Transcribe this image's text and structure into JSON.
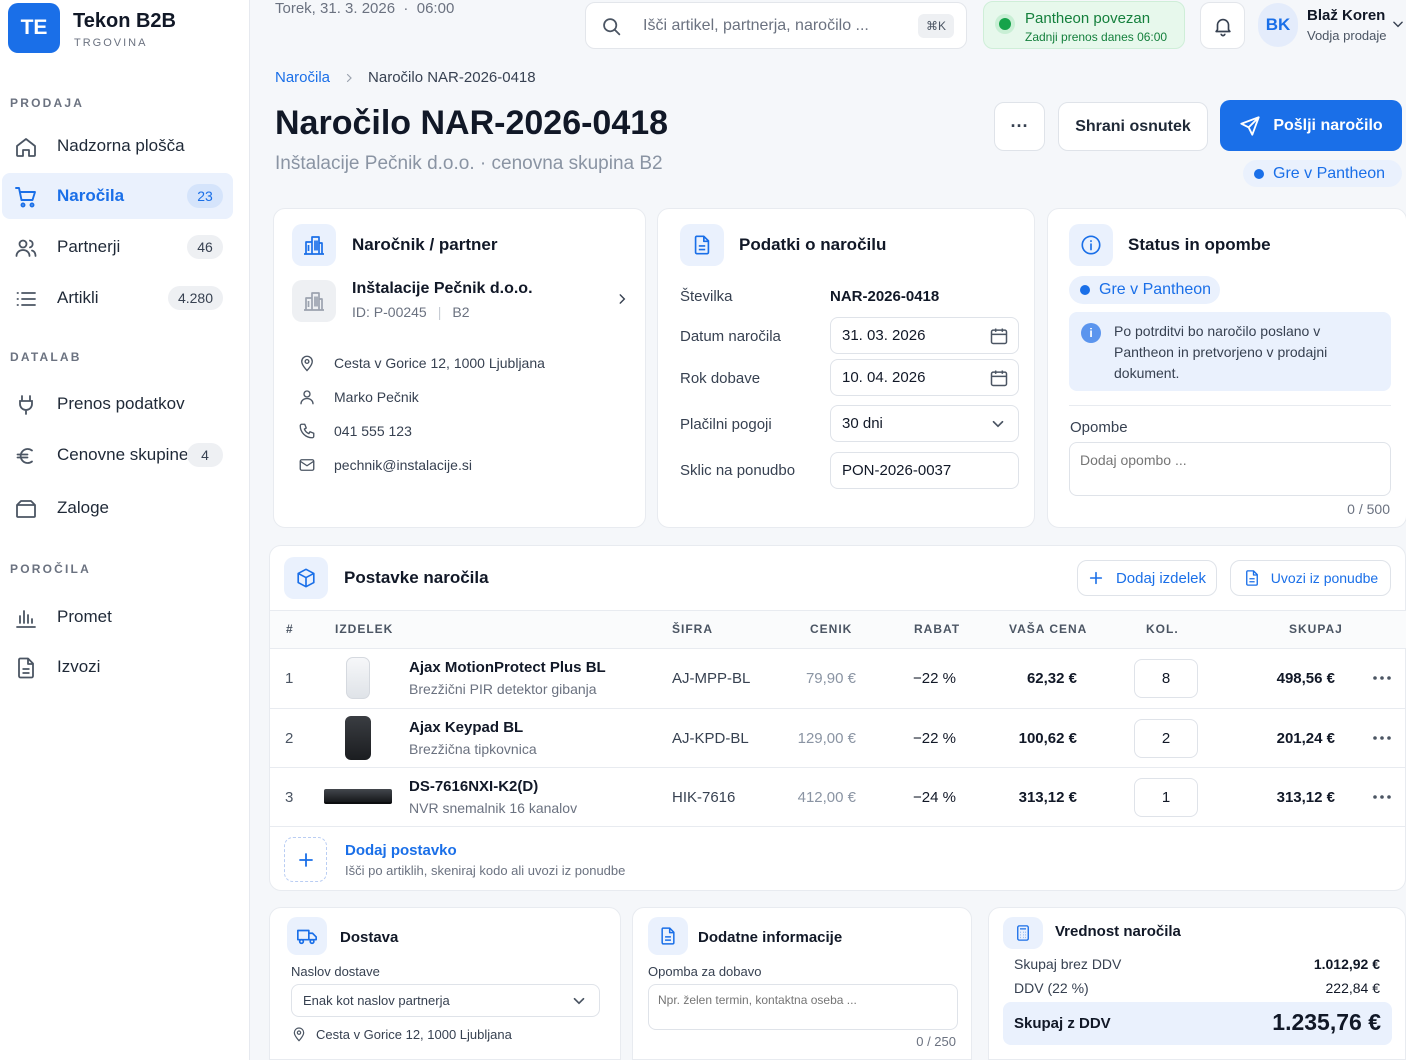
{
  "app": {
    "badge": "TE",
    "name": "Tekon B2B",
    "subtitle": "TRGOVINA"
  },
  "sidebar": {
    "sections": [
      {
        "title": "PRODAJA",
        "items": [
          {
            "label": "Nadzorna plošča",
            "count": "",
            "icon": "home-icon",
            "active": false
          },
          {
            "label": "Naročila",
            "count": "23",
            "icon": "cart-icon",
            "active": true
          },
          {
            "label": "Partnerji",
            "count": "46",
            "icon": "users-icon",
            "active": false
          },
          {
            "label": "Artikli",
            "count": "4.280",
            "icon": "list-icon",
            "active": false
          }
        ]
      },
      {
        "title": "DATALAB",
        "items": [
          {
            "label": "Prenos podatkov",
            "count": "",
            "icon": "plug-icon",
            "active": false
          },
          {
            "label": "Cenovne skupine",
            "count": "4",
            "icon": "euro-icon",
            "active": false
          },
          {
            "label": "Zaloge",
            "count": "",
            "icon": "box-icon",
            "active": false
          }
        ]
      },
      {
        "title": "POROČILA",
        "items": [
          {
            "label": "Promet",
            "count": "",
            "icon": "bar-chart-icon",
            "active": false
          },
          {
            "label": "Izvozi",
            "count": "",
            "icon": "file-icon",
            "active": false
          }
        ]
      }
    ]
  },
  "topbar": {
    "date": "Torek, 31. 3. 2026  ·  06:00",
    "search_placeholder": "Išči artikel, partnerja, naročilo ...",
    "search_shortcut": "⌘K",
    "sync_title": "Pantheon povezan",
    "sync_subtitle": "Zadnji prenos danes 06:00",
    "user_initials": "BK",
    "user_name": "Blaž Koren",
    "user_role": "Vodja prodaje"
  },
  "breadcrumb": {
    "parent": "Naročila",
    "current": "Naročilo NAR-2026-0418"
  },
  "page": {
    "title": "Naročilo NAR-2026-0418",
    "subtitle": "Inštalacije Pečnik d.o.o. · cenovna skupina B2",
    "more_label": "···",
    "draft_button": "Shrani osnutek",
    "send_button": "Pošlji naročilo",
    "status_pill": "Gre v Pantheon"
  },
  "customer": {
    "card_title": "Naročnik / partner",
    "name": "Inštalacije Pečnik d.o.o.",
    "id": "ID: P-00245",
    "group": "B2",
    "address": "Cesta v Gorice 12, 1000 Ljubljana",
    "contact": "Marko Pečnik",
    "phone": "041 555 123",
    "email": "pechnik@instalacije.si"
  },
  "order_info": {
    "card_title": "Podatki o naročilu",
    "number_label": "Številka",
    "number_value": "NAR-2026-0418",
    "date_label": "Datum naročila",
    "date_value": "31. 03. 2026",
    "delivery_label": "Rok dobave",
    "delivery_value": "10. 04. 2026",
    "payment_label": "Plačilni pogoji",
    "payment_value": "30 dni",
    "ref_label": "Sklic na ponudbo",
    "ref_value": "PON-2026-0037"
  },
  "status": {
    "card_title": "Status in opombe",
    "pill": "Gre v Pantheon",
    "info": "Po potrditvi bo naročilo poslano v Pantheon in pretvorjeno v prodajni dokument.",
    "notes_label": "Opombe",
    "notes_placeholder": "Dodaj opombo ...",
    "notes_counter": "0 / 500"
  },
  "items": {
    "card_title": "Postavke naročila",
    "add_product_button": "Dodaj izdelek",
    "import_button": "Uvozi iz ponudbe",
    "columns": [
      "#",
      "IZDELEK",
      "ŠIFRA",
      "CENIK",
      "RABAT",
      "VAŠA CENA",
      "KOL.",
      "SKUPAJ"
    ],
    "rows": [
      {
        "no": "1",
        "name": "Ajax MotionProtect Plus BL",
        "desc": "Brezžični PIR detektor gibanja",
        "code": "AJ-MPP-BL",
        "list_price": "79,90 €",
        "discount": "−22 %",
        "price": "62,32 €",
        "qty": "8",
        "total": "498,56 €"
      },
      {
        "no": "2",
        "name": "Ajax Keypad BL",
        "desc": "Brezžična tipkovnica",
        "code": "AJ-KPD-BL",
        "list_price": "129,00 €",
        "discount": "−22 %",
        "price": "100,62 €",
        "qty": "2",
        "total": "201,24 €"
      },
      {
        "no": "3",
        "name": "DS-7616NXI-K2(D)",
        "desc": "NVR snemalnik 16 kanalov",
        "code": "HIK-7616",
        "list_price": "412,00 €",
        "discount": "−24 %",
        "price": "313,12 €",
        "qty": "1",
        "total": "313,12 €"
      }
    ],
    "add_line_title": "Dodaj postavko",
    "add_line_hint": "Išči po artiklih, skeniraj kodo ali uvozi iz ponudbe"
  },
  "delivery": {
    "card_title": "Dostava",
    "address_label": "Naslov dostave",
    "address_select": "Enak kot naslov partnerja",
    "address_value": "Cesta v Gorice 12, 1000 Ljubljana"
  },
  "extra": {
    "card_title": "Dodatne informacije",
    "note_label": "Opomba za dobavo",
    "note_placeholder": "Npr. želen termin, kontaktna oseba ...",
    "note_counter": "0 / 250"
  },
  "totals": {
    "card_title": "Vrednost naročila",
    "net_label": "Skupaj brez DDV",
    "net_value": "1.012,92 €",
    "vat_label": "DDV (22 %)",
    "vat_value": "222,84 €",
    "gross_label": "Skupaj z DDV",
    "gross_value": "1.235,76 €"
  },
  "colors": {
    "accent": "#1a6fe8",
    "success": "#16a34a"
  }
}
